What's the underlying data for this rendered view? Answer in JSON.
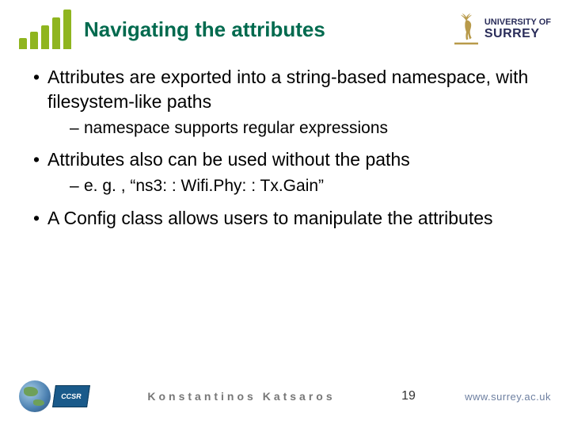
{
  "header": {
    "title": "Navigating the attributes",
    "university_top": "UNIVERSITY OF",
    "university_name": "SURREY"
  },
  "bullets": [
    {
      "text": "Attributes are exported into a string-based namespace, with filesystem-like paths",
      "sub": [
        "namespace supports regular expressions"
      ]
    },
    {
      "text": "Attributes also can be used without the paths",
      "sub": [
        "e. g. , “ns3: : Wifi.Phy: : Tx.Gain”"
      ]
    },
    {
      "text": "A Config class allows users to manipulate the attributes",
      "sub": []
    }
  ],
  "footer": {
    "ccsr_label": "CCSR",
    "author": "Konstantinos Katsaros",
    "page": "19",
    "url": "www.surrey.ac.uk"
  }
}
